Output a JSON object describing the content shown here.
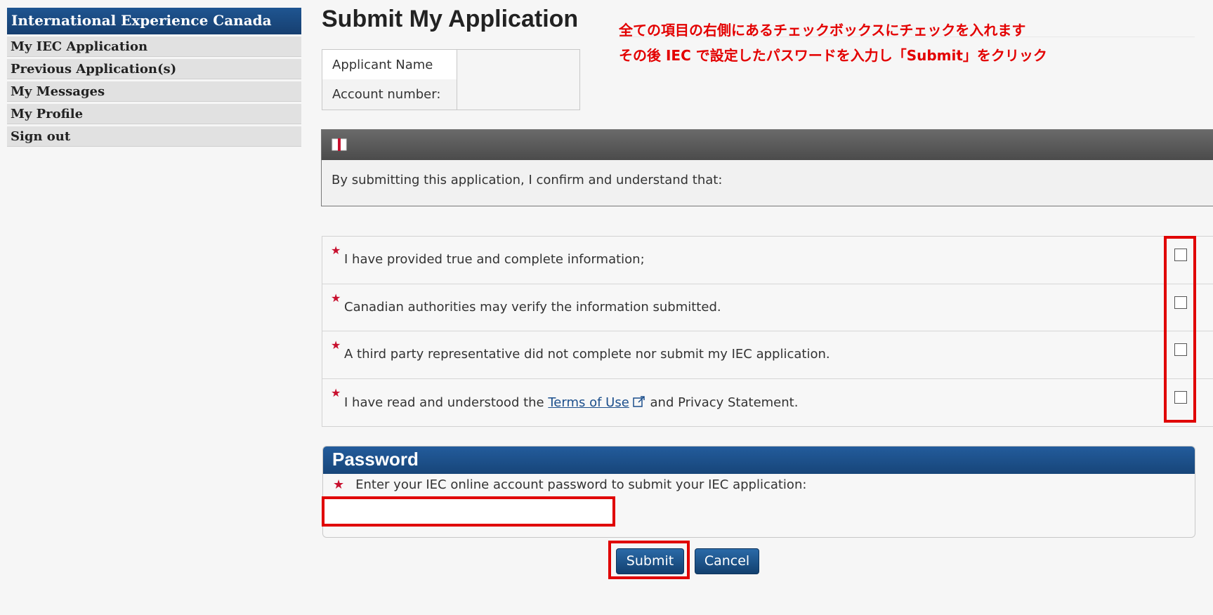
{
  "sidebar": {
    "brand": "International Experience Canada",
    "items": [
      {
        "label": "My IEC Application"
      },
      {
        "label": "Previous Application(s)"
      },
      {
        "label": "My Messages"
      },
      {
        "label": "My Profile"
      },
      {
        "label": "Sign out"
      }
    ]
  },
  "page_title": "Submit My Application",
  "annotation": {
    "line1": "全ての項目の右側にあるチェックボックスにチェックを入れます",
    "line2": "その後 IEC で設定したパスワードを入力し「Submit」をクリック",
    "color": "#e30000"
  },
  "applicant": {
    "name_label": "Applicant Name",
    "account_label": "Account number:",
    "name_value": "",
    "account_value": ""
  },
  "confirm": {
    "icon": "book-icon",
    "intro": "By submitting this application, I confirm and understand that:"
  },
  "declarations": [
    {
      "text": "I have provided true and complete information;",
      "checked": false
    },
    {
      "text": "Canadian authorities may verify the information submitted.",
      "checked": false
    },
    {
      "text": "A third party representative did not complete nor submit my IEC application.",
      "checked": false
    },
    {
      "text_before": "I have read and understood the ",
      "link": "Terms of Use",
      "text_after": " and Privacy Statement.",
      "checked": false
    }
  ],
  "required_marker": "★",
  "password": {
    "heading": "Password",
    "label": "Enter your IEC online account password to submit your IEC application:",
    "value": ""
  },
  "buttons": {
    "submit": "Submit",
    "cancel": "Cancel"
  },
  "colors": {
    "brand_blue": "#1f5591",
    "highlight_red": "#e00000",
    "required_red": "#c8102e"
  }
}
